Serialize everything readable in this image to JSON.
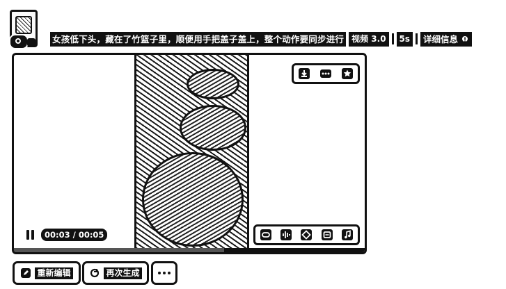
{
  "prompt": {
    "text": "女孩低下头，藏在了竹篮子里，顺便用手把盖子盖上，整个动作要同步进行",
    "model_chip": "视频 3.0",
    "duration_chip": "5s",
    "details_label": "详细信息"
  },
  "player": {
    "timecode": "00:03 / 00:05",
    "progress": 0.6
  },
  "actions": {
    "edit_label": "重新编辑",
    "regenerate_label": "再次生成"
  },
  "icons": {
    "download": "download-icon",
    "more": "more-icon",
    "favorite": "star-icon",
    "effects": [
      "lip-sync-icon",
      "audio-wave-icon",
      "enhance-icon",
      "frame-icon",
      "music-icon"
    ]
  }
}
